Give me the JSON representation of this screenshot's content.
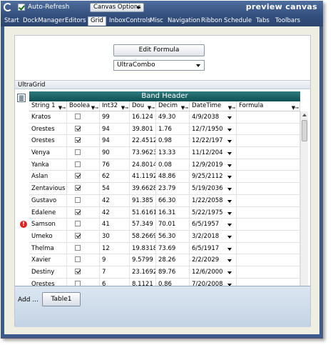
{
  "topbar": {
    "auto_refresh_label": "Auto-Refresh",
    "canvas_options_label": "Canvas Options",
    "preview_title": "preview canvas"
  },
  "tabs": [
    "Start",
    "DockManager",
    "Editors",
    "Grid",
    "InboxControls",
    "Misc",
    "Navigation",
    "Ribbon",
    "Schedule",
    "Tabs",
    "Toolbars"
  ],
  "active_tab": "Grid",
  "form": {
    "edit_formula_label": "Edit Formula",
    "combo_value": "UltraCombo"
  },
  "grid": {
    "caption": "UltraGrid",
    "band_header": "Band Header",
    "columns": [
      "String 1",
      "Boolea",
      "Int32",
      "Dou",
      "Decim",
      "DateTime",
      "Formula"
    ],
    "rows": [
      {
        "string": "Kratos",
        "bool": false,
        "int": "99",
        "dou": "16.124",
        "dec": "49.30",
        "date": "4/9/2038",
        "error": false
      },
      {
        "string": "Orestes",
        "bool": true,
        "int": "94",
        "dou": "39.801",
        "dec": "1.76",
        "date": "12/7/1950",
        "error": false
      },
      {
        "string": "Orestes",
        "bool": true,
        "int": "94",
        "dou": "22.4512",
        "dec": "0.98",
        "date": "12/22/197",
        "error": false
      },
      {
        "string": "Venya",
        "bool": false,
        "int": "90",
        "dou": "73.9623",
        "dec": "13.33",
        "date": "11/12/204",
        "error": false
      },
      {
        "string": "Yanka",
        "bool": false,
        "int": "76",
        "dou": "24.8014",
        "dec": "0.08",
        "date": "12/9/2019",
        "error": false
      },
      {
        "string": "Aslan",
        "bool": true,
        "int": "62",
        "dou": "41.1192",
        "dec": "48.86",
        "date": "9/25/2112",
        "error": false
      },
      {
        "string": "Zentavious",
        "bool": true,
        "int": "54",
        "dou": "39.6628",
        "dec": "23.79",
        "date": "5/19/2036",
        "error": false
      },
      {
        "string": "Gustavo",
        "bool": false,
        "int": "42",
        "dou": "91.385",
        "dec": "66.30",
        "date": "1/22/2058",
        "error": false
      },
      {
        "string": "Edalene",
        "bool": true,
        "int": "42",
        "dou": "51.6161",
        "dec": "16.31",
        "date": "5/22/1975",
        "error": false
      },
      {
        "string": "Samson",
        "bool": false,
        "int": "41",
        "dou": "57.349",
        "dec": "70.01",
        "date": "6/5/1957",
        "error": true
      },
      {
        "string": "Umeko",
        "bool": true,
        "int": "30",
        "dou": "58.2669",
        "dec": "56.30",
        "date": "3/2/2018",
        "error": false
      },
      {
        "string": "Thelma",
        "bool": false,
        "int": "12",
        "dou": "19.8318",
        "dec": "73.69",
        "date": "6/5/1917",
        "error": false
      },
      {
        "string": "Xavier",
        "bool": false,
        "int": "9",
        "dou": "9.5799",
        "dec": "28.26",
        "date": "2/2/2029",
        "error": false
      },
      {
        "string": "Destiny",
        "bool": true,
        "int": "7",
        "dou": "23.1692",
        "dec": "89.76",
        "date": "12/6/2000",
        "error": false
      },
      {
        "string": "Orestes",
        "bool": false,
        "int": "6",
        "dou": "8.1121",
        "dec": "0.86",
        "date": "7/20/2008",
        "error": false
      }
    ],
    "add_label": "Add ...",
    "add_button_label": "Table1"
  }
}
